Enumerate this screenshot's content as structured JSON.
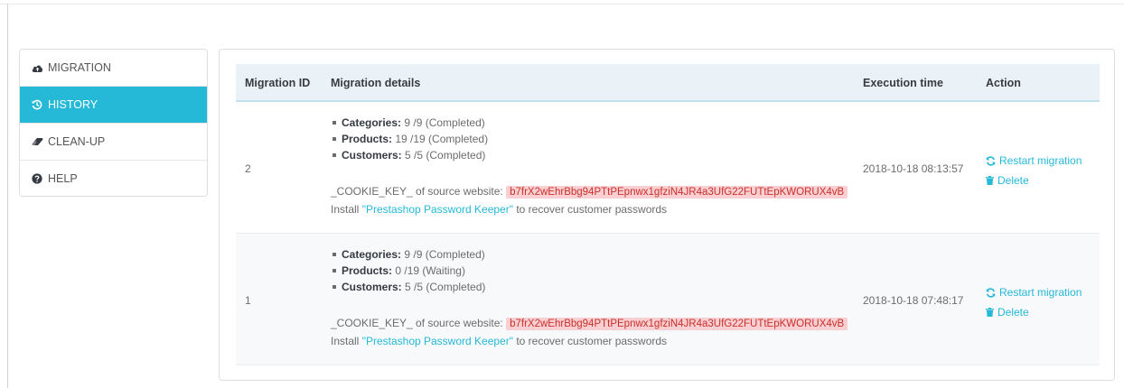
{
  "sidebar": {
    "items": [
      {
        "label": "MIGRATION",
        "icon": "cloud-upload-icon"
      },
      {
        "label": "HISTORY",
        "icon": "history-icon",
        "active": true
      },
      {
        "label": "CLEAN-UP",
        "icon": "eraser-icon"
      },
      {
        "label": "HELP",
        "icon": "question-circle-icon"
      }
    ]
  },
  "table": {
    "headers": {
      "id": "Migration ID",
      "details": "Migration details",
      "time": "Execution time",
      "action": "Action"
    },
    "rows": [
      {
        "id": "2",
        "stats": [
          {
            "label": "Categories:",
            "value": "9 /9 (Completed)"
          },
          {
            "label": "Products:",
            "value": "19 /19 (Completed)"
          },
          {
            "label": "Customers:",
            "value": "5 /5 (Completed)"
          }
        ],
        "cookie_label": "_COOKIE_KEY_ of source website:",
        "cookie_key": "b7frX2wEhrBbg94PTtPEpnwx1gfziN4JR4a3UfG22FUTtEpKWORUX4vB",
        "install_prefix": "Install",
        "install_link": "\"Prestashop Password Keeper\"",
        "install_suffix": "to recover customer passwords",
        "time": "2018-10-18 08:13:57",
        "restart_label": "Restart migration",
        "delete_label": "Delete"
      },
      {
        "id": "1",
        "stats": [
          {
            "label": "Categories:",
            "value": "9 /9 (Completed)"
          },
          {
            "label": "Products:",
            "value": "0 /19 (Waiting)"
          },
          {
            "label": "Customers:",
            "value": "5 /5 (Completed)"
          }
        ],
        "cookie_label": "_COOKIE_KEY_ of source website:",
        "cookie_key": "b7frX2wEhrBbg94PTtPEpnwx1gfziN4JR4a3UfG22FUTtEpKWORUX4vB",
        "install_prefix": "Install",
        "install_link": "\"Prestashop Password Keeper\"",
        "install_suffix": "to recover customer passwords",
        "time": "2018-10-18 07:48:17",
        "restart_label": "Restart migration",
        "delete_label": "Delete"
      }
    ]
  },
  "colors": {
    "accent": "#25b9d7",
    "key_background": "#f9cfd2",
    "key_text": "#c9302c",
    "header_background": "#eaf2f8"
  }
}
